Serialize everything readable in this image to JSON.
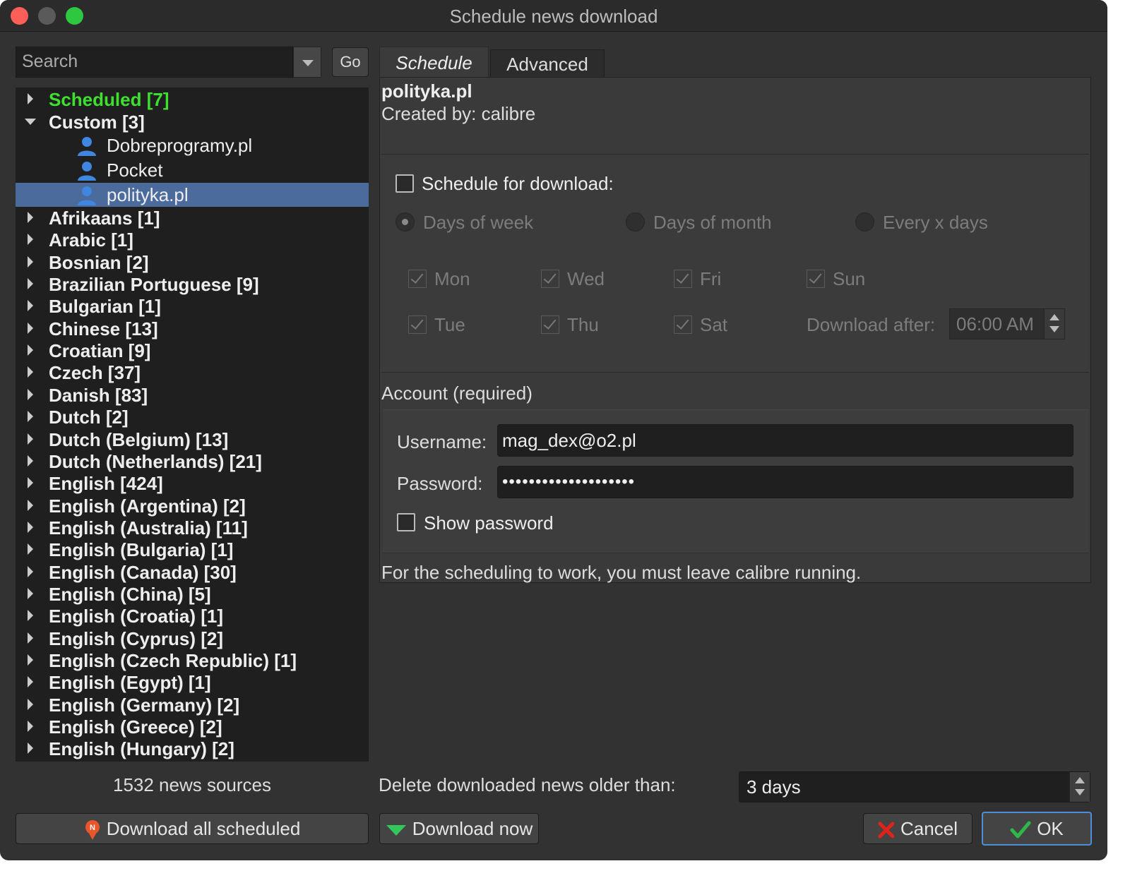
{
  "window": {
    "title": "Schedule news download"
  },
  "search": {
    "placeholder": "Search",
    "go_label": "Go"
  },
  "tree": {
    "scheduled": "Scheduled [7]",
    "custom": "Custom [3]",
    "custom_children": [
      "Dobreprogramy.pl",
      "Pocket",
      "polityka.pl"
    ],
    "languages": [
      "Afrikaans [1]",
      "Arabic [1]",
      "Bosnian [2]",
      "Brazilian Portuguese [9]",
      "Bulgarian [1]",
      "Chinese [13]",
      "Croatian [9]",
      "Czech [37]",
      "Danish [83]",
      "Dutch [2]",
      "Dutch (Belgium) [13]",
      "Dutch (Netherlands) [21]",
      "English [424]",
      "English (Argentina) [2]",
      "English (Australia) [11]",
      "English (Bulgaria) [1]",
      "English (Canada) [30]",
      "English (China) [5]",
      "English (Croatia) [1]",
      "English (Cyprus) [2]",
      "English (Czech Republic) [1]",
      "English (Egypt) [1]",
      "English (Germany) [2]",
      "English (Greece) [2]",
      "English (Hungary) [2]"
    ],
    "selected": "polityka.pl"
  },
  "status": {
    "source_count": "1532 news sources"
  },
  "tabs": {
    "schedule": "Schedule",
    "advanced": "Advanced",
    "active": "Schedule"
  },
  "recipe": {
    "title": "polityka.pl",
    "created_by": "Created by: calibre"
  },
  "schedule": {
    "enable_label": "Schedule for download:",
    "enabled": false,
    "modes": [
      "Days of  week",
      "Days of month",
      "Every x days"
    ],
    "selected_mode": "Days of  week",
    "days": {
      "mon": "Mon",
      "tue": "Tue",
      "wed": "Wed",
      "thu": "Thu",
      "fri": "Fri",
      "sat": "Sat",
      "sun": "Sun"
    },
    "download_after_label": "Download after:",
    "download_after_value": "06:00 AM"
  },
  "account": {
    "heading": "Account (required)",
    "username_label": "Username:",
    "username_value": "mag_dex@o2.pl",
    "password_label": "Password:",
    "password_mask": "••••••••••••••••••••",
    "show_password_label": "Show password"
  },
  "note": "For the scheduling to work, you must leave calibre running.",
  "delete_older": {
    "label": "Delete downloaded news older than:",
    "value": "3 days"
  },
  "buttons": {
    "download_all": "Download all scheduled",
    "download_now": "Download now",
    "cancel": "Cancel",
    "ok": "OK"
  },
  "colors": {
    "selection": "#4a6b9c",
    "scheduled_green": "#3ee02f",
    "ok_border": "#4a8fd8"
  }
}
